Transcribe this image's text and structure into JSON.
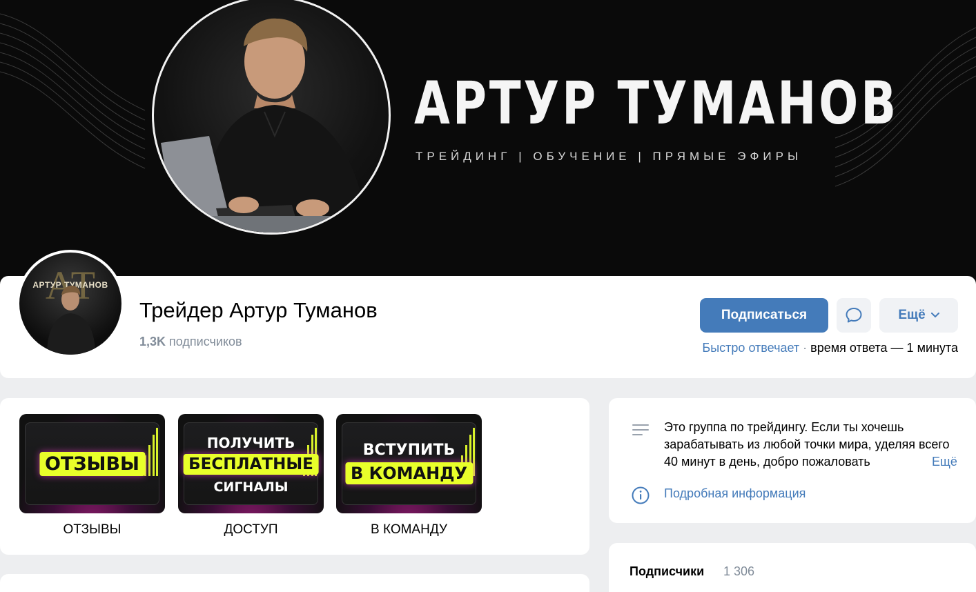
{
  "cover": {
    "title": "АРТУР ТУМАНОВ",
    "subtitle": "ТРЕЙДИНГ | ОБУЧЕНИЕ | ПРЯМЫЕ ЭФИРЫ"
  },
  "header": {
    "avatar_text": "АРТУР ТУМАНОВ",
    "avatar_monogram": "АТ",
    "group_name": "Трейдер Артур Туманов",
    "subscribers_count": "1,3K",
    "subscribers_label": "подписчиков",
    "subscribe_button": "Подписаться",
    "message_icon": "message-icon",
    "more_button": "Ещё",
    "reply_fast": "Быстро отвечает",
    "reply_separator": "·",
    "reply_time": "время ответа — 1 минута"
  },
  "tiles": [
    {
      "line1": "",
      "highlight": "ОТЗЫВЫ",
      "line3": "",
      "caption": "ОТЗЫВЫ"
    },
    {
      "line1": "ПОЛУЧИТЬ",
      "highlight": "БЕСПЛАТНЫЕ",
      "line3": "СИГНАЛЫ",
      "caption": "ДОСТУП"
    },
    {
      "line1": "ВСТУПИТЬ",
      "highlight": "В КОМАНДУ",
      "line3": "",
      "caption": "В КОМАНДУ"
    }
  ],
  "about": {
    "description": "Это группа по трейдингу. Если ты хочешь зарабатывать из любой точки мира, уделяя всего 40 минут в день, добро пожаловать",
    "more_link": "Ещё",
    "info_link": "Подробная информация"
  },
  "followers": {
    "label": "Подписчики",
    "count": "1 306"
  },
  "colors": {
    "accent": "#447bba",
    "highlight": "#e9ff2a",
    "muted": "#818c99"
  }
}
